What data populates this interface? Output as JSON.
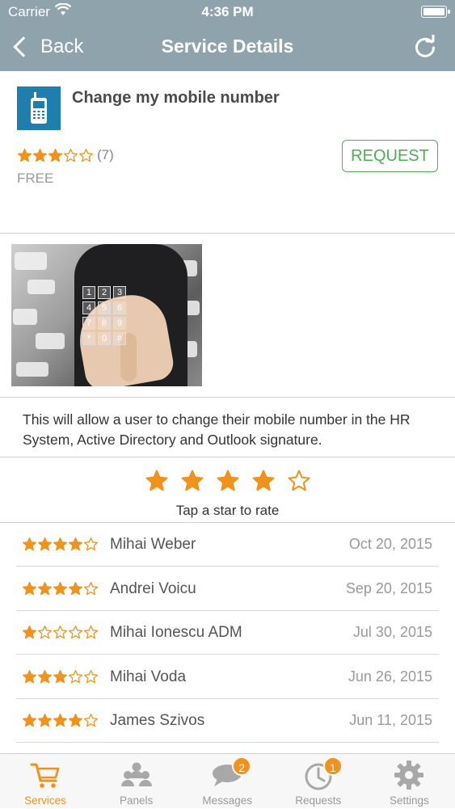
{
  "status_bar": {
    "carrier": "Carrier",
    "time": "4:36 PM"
  },
  "nav": {
    "back_label": "Back",
    "title": "Service Details"
  },
  "service": {
    "title": "Change my mobile number",
    "rating": 3,
    "rating_count": "(7)",
    "price": "FREE",
    "request_label": "REQUEST",
    "description": "This will allow a user to change their mobile number in the HR System, Active Directory and Outlook signature."
  },
  "rate": {
    "current": 4,
    "max": 5,
    "label": "Tap a star to rate"
  },
  "reviews": [
    {
      "stars": 4,
      "name": "Mihai Weber",
      "date": "Oct 20, 2015"
    },
    {
      "stars": 4,
      "name": "Andrei Voicu",
      "date": "Sep 20, 2015"
    },
    {
      "stars": 1,
      "name": "Mihai Ionescu ADM",
      "date": "Jul 30, 2015"
    },
    {
      "stars": 3,
      "name": "Mihai Voda",
      "date": "Jun 26, 2015"
    },
    {
      "stars": 4,
      "name": "James Szivos",
      "date": "Jun 11, 2015"
    }
  ],
  "tabs": [
    {
      "label": "Services",
      "icon": "cart-icon",
      "active": true
    },
    {
      "label": "Panels",
      "icon": "people-icon",
      "active": false
    },
    {
      "label": "Messages",
      "icon": "chat-icon",
      "active": false,
      "badge": "2"
    },
    {
      "label": "Requests",
      "icon": "clock-icon",
      "active": false,
      "badge": "1"
    },
    {
      "label": "Settings",
      "icon": "gear-icon",
      "active": false
    }
  ],
  "colors": {
    "accent": "#f0921c",
    "nav_bar": "#8fa3ad",
    "request": "#4caf50",
    "service_icon_bg": "#1e7fae"
  }
}
